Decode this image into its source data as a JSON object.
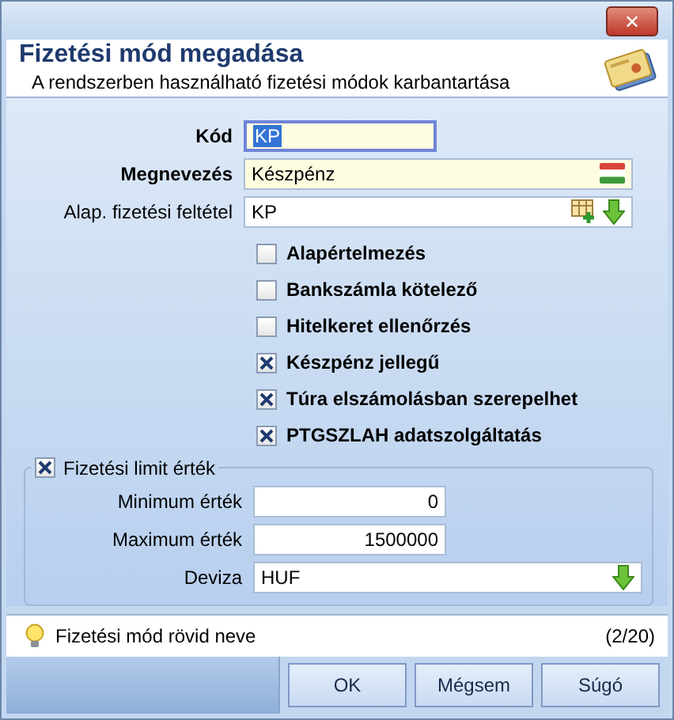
{
  "window": {
    "close": "✕"
  },
  "header": {
    "title": "Fizetési mód megadása",
    "subtitle": "A rendszerben használható fizetési módok karbantartása"
  },
  "fields": [
    {
      "kind": "code",
      "label": "Kód",
      "value": "KP",
      "required": true,
      "focused": true
    },
    {
      "kind": "text",
      "label": "Megnevezés",
      "value": "Készpénz",
      "required": true,
      "focused": false
    },
    {
      "kind": "lookup",
      "label": "Alap. fizetési feltétel",
      "value": "KP",
      "required": false,
      "focused": false,
      "can_add": true
    }
  ],
  "checkboxes": [
    {
      "label": "Alapértelmezés",
      "checked": false
    },
    {
      "label": "Bankszámla kötelező",
      "checked": false
    },
    {
      "label": "Hitelkeret ellenőrzés",
      "checked": false
    },
    {
      "label": "Készpénz jellegű",
      "checked": true
    },
    {
      "label": "Túra elszámolásban szerepelhet",
      "checked": true
    },
    {
      "label": "PTGSZLAH adatszolgáltatás",
      "checked": true
    }
  ],
  "limit_group": {
    "label": "Fizetési limit érték",
    "checked": true,
    "fields": [
      {
        "kind": "number",
        "label": "Minimum érték",
        "value": "0"
      },
      {
        "kind": "number",
        "label": "Maximum érték",
        "value": "1500000"
      },
      {
        "kind": "lookup",
        "label": "Deviza",
        "value": "HUF",
        "can_add": false
      }
    ]
  },
  "hint": {
    "text": "Fizetési mód rövid neve",
    "counter": "(2/20)"
  },
  "buttons": [
    "OK",
    "Mégsem",
    "Súgó"
  ]
}
